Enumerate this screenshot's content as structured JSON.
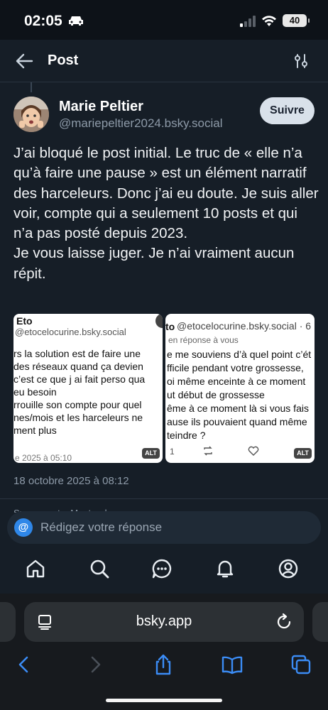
{
  "status_bar": {
    "time": "02:05",
    "battery": "40"
  },
  "header": {
    "title": "Post"
  },
  "author": {
    "name": "Marie Peltier",
    "handle": "@mariepeltier2024.bsky.social",
    "follow_label": "Suivre"
  },
  "post": {
    "text": "J’ai bloqué le post initial. Le truc de « elle n’a qu’à faire une pause » est un élément narratif des harceleurs. Donc j’ai eu doute. Je suis aller voir, compte qui a seulement 10 posts et qui n’a pas posté depuis 2023.\nJe vous laisse juger. Je n’ai vraiment aucun répit.",
    "date": "18 octobre 2025 à 08:12"
  },
  "images": [
    {
      "name": "Eto",
      "handle": "@etocelocurine.bsky.social",
      "lines": [
        "rs la solution est de faire une",
        " des réseaux quand ça devien",
        "c’est ce que j ai fait perso qua",
        "eu besoin",
        "rrouille son compte pour quel",
        "nes/mois et les harceleurs ne",
        "ment plus"
      ],
      "date": "e 2025 à 05:10",
      "alt": "ALT"
    },
    {
      "name": "to",
      "handle": "@etocelocurine.bsky.social · 6",
      "reply_to": "en réponse à vous",
      "lines": [
        "e me souviens d’à quel point c’ét",
        "fficile pendant votre grossesse,",
        "oi même enceinte à ce moment",
        "ut début de grossesse",
        "ême à ce moment là si vous fais",
        "ause ils pouvaient quand même",
        "teindre ?"
      ],
      "like_count": "1",
      "alt": "ALT"
    }
  ],
  "partial_row": "Sur ce post... Montrer les",
  "reply": {
    "placeholder": "Rédigez votre réponse"
  },
  "tabs": [
    "home-icon",
    "search-icon",
    "chat-icon",
    "bell-icon",
    "profile-icon"
  ],
  "browser": {
    "url": "bsky.app"
  },
  "colors": {
    "background": "#161e27",
    "accent": "#2f87e8",
    "follow_bg": "#d9e1ea"
  }
}
